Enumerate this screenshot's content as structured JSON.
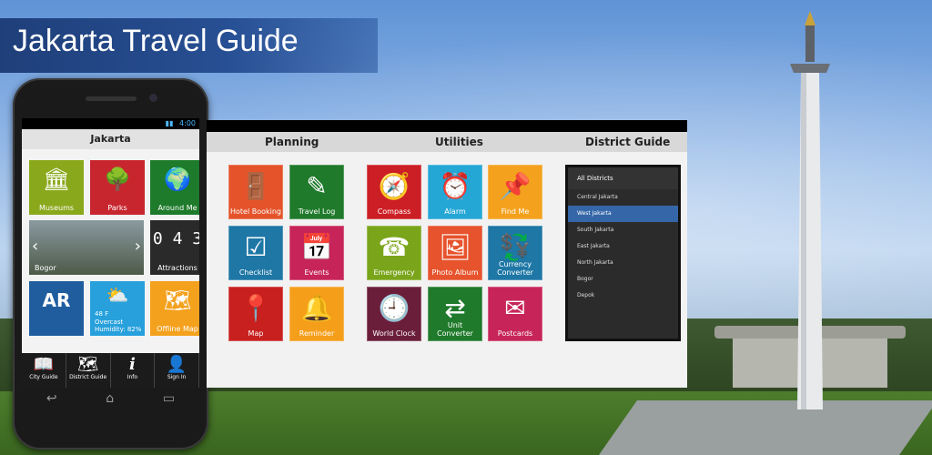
{
  "banner": {
    "title": "Jakarta Travel Guide"
  },
  "phone": {
    "status_time": "4:00",
    "header": "Jakarta",
    "tiles": [
      {
        "label": "Museums",
        "icon": "column-icon",
        "glyph": "🏛",
        "color": "#8aa81b"
      },
      {
        "label": "Parks",
        "icon": "tree-icon",
        "glyph": "🌳",
        "color": "#c8262f"
      },
      {
        "label": "Around Me",
        "icon": "globe-pin-icon",
        "glyph": "🌍",
        "color": "#1e7b2b"
      },
      {
        "label": "Bogor",
        "icon": "photo-carousel",
        "glyph": "",
        "color": "#5a6b5a"
      },
      {
        "label": "Attractions",
        "icon": "digital-counter-icon",
        "glyph": "0 4 3",
        "color": "#2a2a2a"
      },
      {
        "label": "",
        "icon": "ar-icon",
        "glyph": "AR",
        "color": "#1f5d9f"
      },
      {
        "label": "Humidity: 82%",
        "icon": "weather-icon",
        "glyph": "⛅",
        "color": "#27a0dc",
        "temp": "48  F",
        "condition": "Overcast"
      },
      {
        "label": "Offline Map",
        "icon": "map-icon",
        "glyph": "🗺",
        "color": "#f4a11d"
      }
    ],
    "nav": [
      {
        "label": "City Guide",
        "icon": "book-icon",
        "glyph": "📖"
      },
      {
        "label": "District Guide",
        "icon": "map-outline-icon",
        "glyph": "🗺"
      },
      {
        "label": "Info",
        "icon": "info-icon",
        "glyph": "i"
      },
      {
        "label": "Sign In",
        "icon": "user-icon",
        "glyph": "👤"
      }
    ],
    "keys": [
      "↩",
      "⌂",
      "▭"
    ]
  },
  "panel": {
    "headings": [
      "Planning",
      "Utilities",
      "District Guide"
    ],
    "planning": [
      {
        "label": "Hotel Booking",
        "icon": "door-hanger-icon",
        "glyph": "🚪",
        "color": "#e4532a"
      },
      {
        "label": "Travel Log",
        "icon": "edit-icon",
        "glyph": "✎",
        "color": "#1f7a2b"
      },
      {
        "label": "Checklist",
        "icon": "checkbox-icon",
        "glyph": "☑",
        "color": "#1e77a5"
      },
      {
        "label": "Events",
        "icon": "calendar-icon",
        "glyph": "📅",
        "color": "#c7255a"
      },
      {
        "label": "Map",
        "icon": "map-pin-icon",
        "glyph": "📍",
        "color": "#c8201f"
      },
      {
        "label": "Reminder",
        "icon": "bell-icon",
        "glyph": "🔔",
        "color": "#f59e1a"
      }
    ],
    "utilities": [
      {
        "label": "Compass",
        "icon": "compass-icon",
        "glyph": "🧭",
        "color": "#cc1f25"
      },
      {
        "label": "Alarm",
        "icon": "alarm-icon",
        "glyph": "⏰",
        "color": "#25a7d6"
      },
      {
        "label": "Find Me",
        "icon": "pushpin-icon",
        "glyph": "📌",
        "color": "#f4a11d"
      },
      {
        "label": "Emergency",
        "icon": "phone-person-icon",
        "glyph": "☎",
        "color": "#7aa51b"
      },
      {
        "label": "Photo Album",
        "icon": "photos-icon",
        "glyph": "🖼",
        "color": "#e6532c"
      },
      {
        "label": "Currency Converter",
        "icon": "currency-icon",
        "glyph": "💱",
        "color": "#1e77a5"
      },
      {
        "label": "World Clock",
        "icon": "clock-icon",
        "glyph": "🕘",
        "color": "#6b1e3a"
      },
      {
        "label": "Unit Converter",
        "icon": "arrows-icon",
        "glyph": "⇄",
        "color": "#1f7a2b"
      },
      {
        "label": "Postcards",
        "icon": "postcard-icon",
        "glyph": "✉",
        "color": "#c7255a"
      }
    ],
    "districts": {
      "title": "All Districts",
      "items": [
        "Central Jakarta",
        "West Jakarta",
        "South Jakarta",
        "East Jakarta",
        "North Jakarta",
        "Bogor",
        "Depok"
      ],
      "selected": "West Jakarta"
    }
  }
}
